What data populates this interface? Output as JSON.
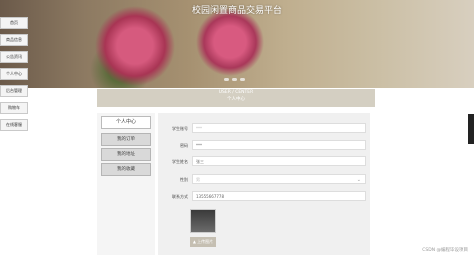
{
  "header": {
    "title": "校园闲置商品交易平台"
  },
  "sidebar": {
    "items": [
      {
        "label": "首页"
      },
      {
        "label": "商品信息"
      },
      {
        "label": "公告资讯"
      },
      {
        "label": "个人中心"
      },
      {
        "label": "后台管理"
      },
      {
        "label": "购物车"
      },
      {
        "label": "在线客服"
      }
    ]
  },
  "section": {
    "en": "USER / CENTER",
    "cn": "个人中心"
  },
  "user_menu": {
    "title": "个人中心",
    "items": [
      {
        "label": "我的订单"
      },
      {
        "label": "我的地址"
      },
      {
        "label": "我的收藏"
      }
    ]
  },
  "form": {
    "fields": [
      {
        "label": "学生账号",
        "value": "",
        "placeholder": "***"
      },
      {
        "label": "密码",
        "value": "***",
        "placeholder": ""
      },
      {
        "label": "学生姓名",
        "value": "张三",
        "placeholder": ""
      },
      {
        "label": "性别",
        "value": "",
        "placeholder": "男"
      },
      {
        "label": "联系方式",
        "value": "13555667778",
        "placeholder": ""
      }
    ],
    "upload_label": "上传图片"
  },
  "watermark": "CSDN @编程毕设项目",
  "colors": {
    "accent": "#c5bfb2",
    "strip": "#d4cfc2"
  }
}
